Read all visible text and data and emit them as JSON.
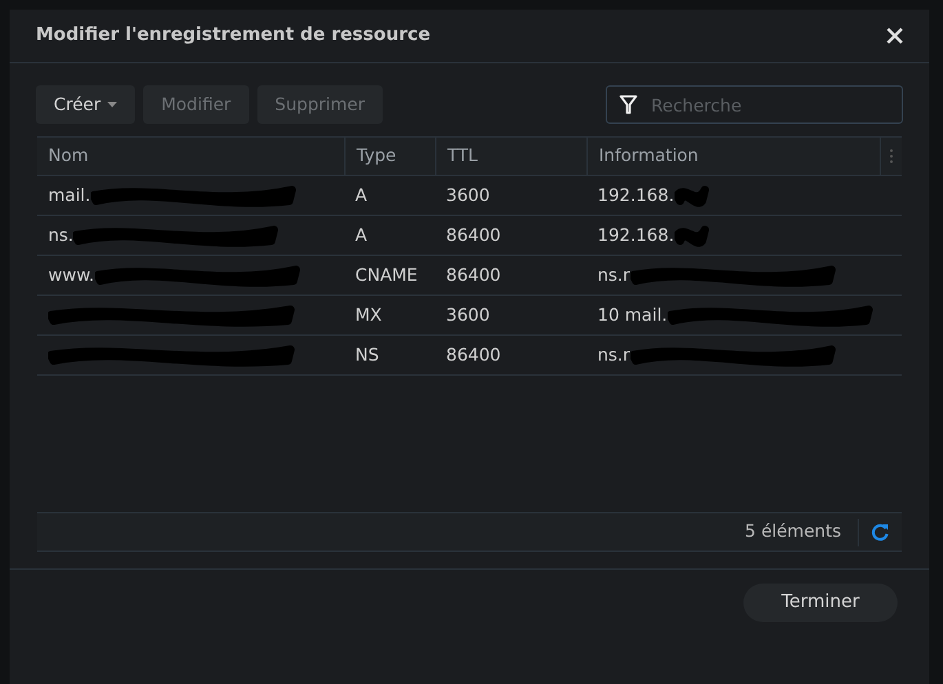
{
  "dialog": {
    "title": "Modifier l'enregistrement de ressource"
  },
  "toolbar": {
    "buttons": [
      {
        "label": "Créer",
        "kind": "dropdown",
        "disabled": false
      },
      {
        "label": "Modifier",
        "kind": "plain",
        "disabled": true
      },
      {
        "label": "Supprimer",
        "kind": "plain",
        "disabled": true
      }
    ],
    "search": {
      "placeholder": "Recherche"
    }
  },
  "table": {
    "columns": [
      "Nom",
      "Type",
      "TTL",
      "Information"
    ],
    "rows": [
      {
        "nom": "mail.",
        "nom_redacted": true,
        "type": "A",
        "ttl": "3600",
        "info": "192.168.",
        "info_redacted": true
      },
      {
        "nom": "ns.",
        "nom_redacted": true,
        "type": "A",
        "ttl": "86400",
        "info": "192.168.",
        "info_redacted": true
      },
      {
        "nom": "www.",
        "nom_redacted": true,
        "type": "CNAME",
        "ttl": "86400",
        "info": "ns.r",
        "info_redacted": true
      },
      {
        "nom_redacted": true,
        "type": "MX",
        "ttl": "3600",
        "info": "10 mail.",
        "info_redacted": true
      },
      {
        "nom_redacted": true,
        "type": "NS",
        "ttl": "86400",
        "info": "ns.r",
        "info_redacted": true
      }
    ]
  },
  "footer": {
    "count": "5 éléments"
  },
  "done_button": "Terminer"
}
